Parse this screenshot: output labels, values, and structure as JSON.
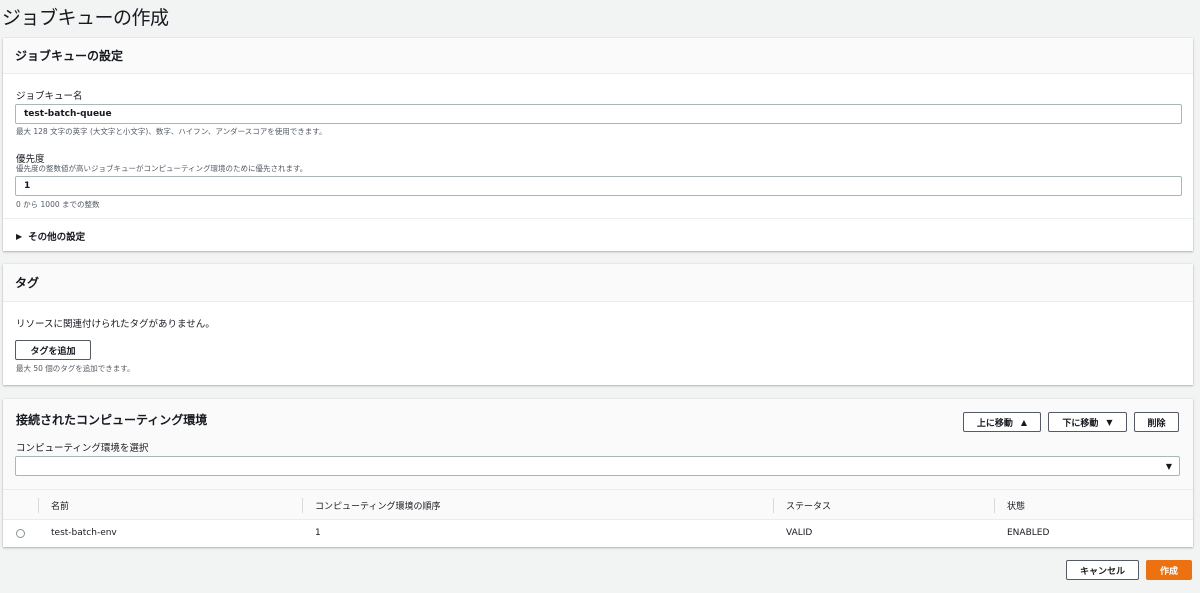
{
  "page": {
    "title": "ジョブキューの作成"
  },
  "settings": {
    "header": "ジョブキューの設定",
    "name_label": "ジョブキュー名",
    "name_value": "test-batch-queue",
    "name_hint": "最大 128 文字の英字 (大文字と小文字)、数字、ハイフン、アンダースコアを使用できます。",
    "priority_label": "優先度",
    "priority_desc": "優先度の整数値が高いジョブキューがコンピューティング環境のために優先されます。",
    "priority_value": "1",
    "priority_hint": "0 から 1000 までの整数",
    "other_settings": "その他の設定"
  },
  "tags": {
    "header": "タグ",
    "empty_text": "リソースに関連付けられたタグがありません。",
    "add_button": "タグを追加",
    "hint": "最大 50 個のタグを追加できます。"
  },
  "compute": {
    "header": "接続されたコンピューティング環境",
    "move_up": "上に移動",
    "move_down": "下に移動",
    "delete": "削除",
    "select_label": "コンピューティング環境を選択",
    "select_value": "",
    "columns": [
      "名前",
      "コンピューティング環境の順序",
      "ステータス",
      "状態"
    ],
    "rows": [
      {
        "name": "test-batch-env",
        "order": "1",
        "status": "VALID",
        "state": "ENABLED"
      }
    ]
  },
  "footer": {
    "cancel": "キャンセル",
    "create": "作成"
  },
  "colors": {
    "primary": "#ec7211",
    "background": "#f2f3f3",
    "border": "#aab7b8"
  },
  "icons": {
    "expand": "caret-right-icon",
    "up": "triangle-up-icon",
    "down": "triangle-down-icon",
    "select": "triangle-down-icon"
  }
}
